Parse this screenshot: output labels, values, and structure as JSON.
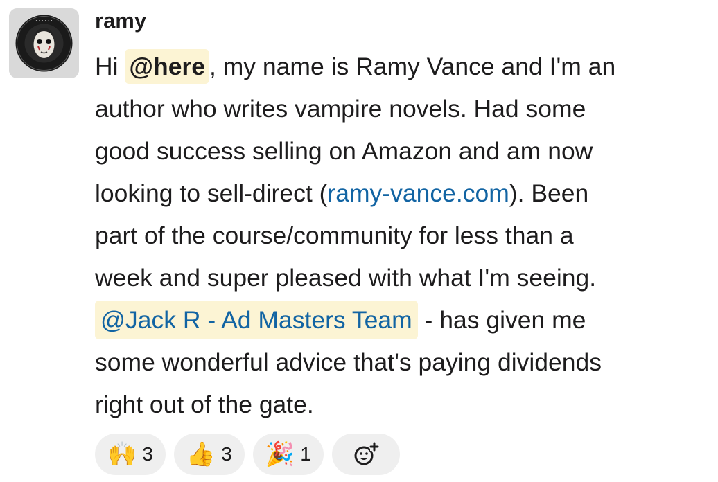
{
  "message": {
    "author": "ramy ",
    "lines": {
      "l1_pre": "Hi ",
      "l1_mention": "@here",
      "l1_post": ", my name is Ramy Vance and I'm an",
      "l2": "author who writes vampire novels. Had some",
      "l3": "good success selling on Amazon and am now",
      "l4_pre": "looking to sell-direct (",
      "l4_link": "ramy-vance.com",
      "l4_post": "). Been",
      "l5": "part of the course/community for less than a",
      "l6": "week and super pleased with what I'm seeing.",
      "l7_mention": "@Jack R - Ad Masters Team",
      "l7_post": " - has given me",
      "l8": "some wonderful advice that's paying dividends",
      "l9": "right out of the gate."
    }
  },
  "reactions": [
    {
      "emoji": "🙌",
      "icon": "raised-hands-icon",
      "count": "3"
    },
    {
      "emoji": "👍",
      "icon": "thumbs-up-icon",
      "count": "3"
    },
    {
      "emoji": "🎉",
      "icon": "party-popper-icon",
      "count": "1"
    }
  ],
  "add_reaction_icon": "add-reaction-icon",
  "colors": {
    "mention_bg": "#fcf4d4",
    "link": "#1264a3",
    "text": "#1d1c1d",
    "reaction_bg": "#efefef"
  }
}
